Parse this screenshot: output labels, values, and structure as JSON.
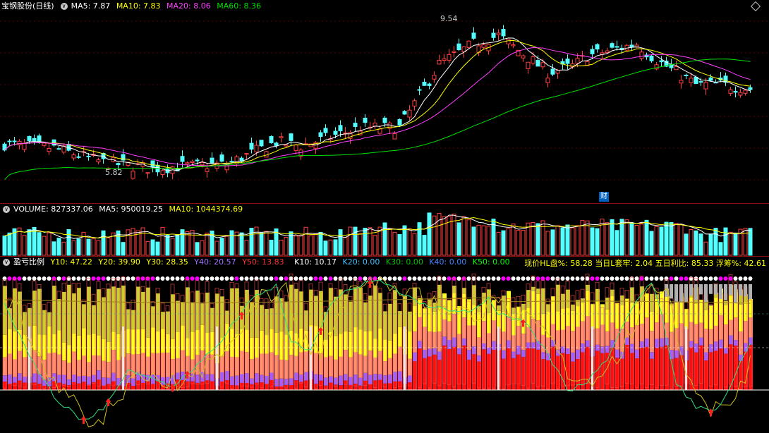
{
  "price_panel": {
    "stock_name": "宝钢股份(日线)",
    "ma5": "MA5: 7.87",
    "ma10": "MA10: 7.83",
    "ma20": "MA20: 8.06",
    "ma60": "MA60: 8.36",
    "high_marker": "9.54",
    "low_marker": "5.82",
    "finance_marker": "财",
    "colors": {
      "ma5": "#ffffff",
      "ma10": "#ffff00",
      "ma20": "#ff40ff",
      "ma60": "#00e000",
      "up": "#ff4040",
      "down": "#54ffff"
    }
  },
  "volume_panel": {
    "volume": "VOLUME: 827337.06",
    "ma5": "MA5: 950019.25",
    "ma10": "MA10: 1044374.69"
  },
  "profit_panel": {
    "title": "盈亏比例",
    "y10": "Y10: 47.22",
    "y20": "Y20: 39.90",
    "y30": "Y30: 28.35",
    "y40": "Y40: 20.57",
    "y50": "Y50: 13.83",
    "k10": "K10: 10.17",
    "k20": "K20: 0.00",
    "k30": "K30: 0.00",
    "k40": "K40: 0.00",
    "k50": "K50: 0.00",
    "hl_ratio": "现价HL盘%: 58.28",
    "today_trapped": "当日L套牢: 2.04",
    "five_day_profit": "五日利比: 85.33",
    "floating": "浮筹%: 42.61",
    "colors": {
      "y10": "#ffff00",
      "y20": "#ffff00",
      "y30": "#ffff00",
      "y40": "#a070ff",
      "y50": "#ff3030",
      "k10": "#ffffff",
      "k20": "#40c0ff",
      "k30": "#00c000",
      "k40": "#4080ff",
      "k50": "#00ff00"
    }
  }
}
